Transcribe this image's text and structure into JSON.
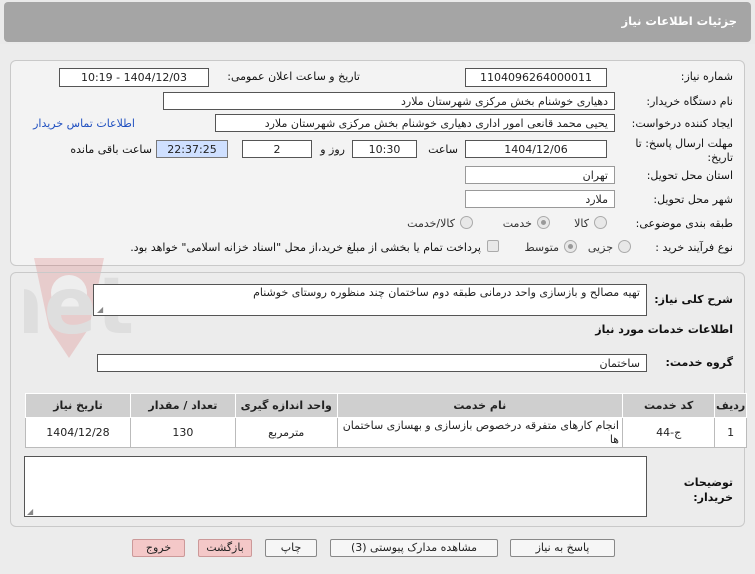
{
  "header": {
    "title": "جزئیات اطلاعات نیاز"
  },
  "labels": {
    "need_number": "شماره نیاز:",
    "announce_datetime": "تاریخ و ساعت اعلان عمومی:",
    "buyer_org": "نام دستگاه خریدار:",
    "requester": "ایجاد کننده درخواست:",
    "deadline": "مهلت ارسال پاسخ: تا تاریخ:",
    "hour": "ساعت",
    "day_and": "روز و",
    "remaining": "ساعت باقی مانده",
    "province": "استان محل تحویل:",
    "city": "شهر محل تحویل:",
    "category": "طبقه بندی موضوعی:",
    "process": "نوع فرآیند خرید :",
    "description": "شرح کلی نیاز:",
    "services_info": "اطلاعات خدمات مورد نیاز",
    "service_group": "گروه خدمت:",
    "buyer_notes": "توضیحات خریدار:"
  },
  "values": {
    "need_number": "1104096264000011",
    "announce_datetime": "1404/12/03 - 10:19",
    "buyer_org": "دهیاری خوشنام بخش مرکزی شهرستان ملارد",
    "requester": "یحیی محمد قانعی امور اداری دهیاری خوشنام بخش مرکزی شهرستان ملارد",
    "contact_link": "اطلاعات تماس خریدار",
    "deadline_date": "1404/12/06",
    "deadline_time": "10:30",
    "days": "2",
    "remaining_time": "22:37:25",
    "province": "تهران",
    "city": "ملارد",
    "description": "تهیه مصالح و بازسازی واحد درمانی طبقه دوم ساختمان چند منظوره روستای خوشنام",
    "service_group": "ساختمان",
    "buyer_notes": ""
  },
  "category_options": [
    "کالا",
    "خدمت",
    "کالا/خدمت"
  ],
  "category_selected": "خدمت",
  "process_options": [
    "جزیی",
    "متوسط"
  ],
  "process_selected": "متوسط",
  "payment_note": "پرداخت تمام یا بخشی از مبلغ خرید،از محل \"اسناد خزانه اسلامی\" خواهد بود.",
  "table": {
    "headers": [
      "ردیف",
      "کد خدمت",
      "نام خدمت",
      "واحد اندازه گیری",
      "تعداد / مقدار",
      "تاریخ نیاز"
    ],
    "rows": [
      [
        "1",
        "ج-44",
        "انجام کارهای متفرقه درخصوص بازسازی و بهسازی ساختمان ها",
        "مترمربع",
        "130",
        "1404/12/28"
      ]
    ]
  },
  "buttons": {
    "reply": "پاسخ به نیاز",
    "attachments": "مشاهده مدارک پیوستی (3)",
    "print": "چاپ",
    "back": "بازگشت",
    "exit": "خروج"
  },
  "watermark": "AriaTender.net"
}
